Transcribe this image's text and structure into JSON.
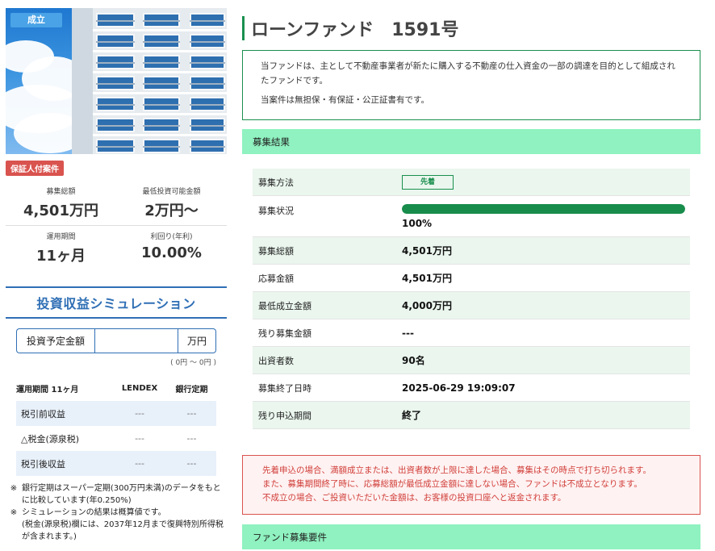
{
  "listing": {
    "status_badge": "成立",
    "guarantor_tag": "保証人付案件",
    "stats": [
      {
        "label": "募集総額",
        "value": "4,501万円"
      },
      {
        "label": "最低投資可能金額",
        "value": "2万円〜"
      },
      {
        "label": "運用期間",
        "value": "11ヶ月"
      },
      {
        "label": "利回り(年利)",
        "value": "10.00%"
      }
    ]
  },
  "simulation": {
    "title": "投資収益シミュレーション",
    "input_label": "投資予定金額",
    "input_value": "",
    "input_unit": "万円",
    "range_note": "( 0円 〜 0円 )",
    "table": {
      "headers": [
        "運用期間 11ヶ月",
        "LENDEX",
        "銀行定期"
      ],
      "rows": [
        {
          "label": "税引前収益",
          "lendex": "---",
          "bank": "---"
        },
        {
          "label": "△税金(源泉税)",
          "lendex": "---",
          "bank": "---"
        },
        {
          "label": "税引後収益",
          "lendex": "---",
          "bank": "---"
        }
      ]
    },
    "notes": [
      {
        "mark": "※",
        "text": "銀行定期はスーパー定期(300万円未満)のデータをもとに比較しています(年0.250%)"
      },
      {
        "mark": "※",
        "text": "シミュレーションの結果は概算値です。"
      }
    ],
    "note_sub": "(税金(源泉税)欄には、2037年12月まで復興特別所得税が含まれます。)"
  },
  "fund": {
    "title": "ローンファンド",
    "number": "1591号",
    "description": [
      "当ファンドは、主として不動産事業者が新たに購入する不動産の仕入資金の一部の調達を目的として組成されたファンドです。",
      "当案件は無担保・有保証・公正証書有です。"
    ]
  },
  "results": {
    "section_title": "募集結果",
    "method_label": "募集方法",
    "method_badge": "先着",
    "status_label": "募集状況",
    "progress_percent": 100,
    "progress_text": "100%",
    "rows": [
      {
        "label": "募集総額",
        "value": "4,501万円"
      },
      {
        "label": "応募金額",
        "value": "4,501万円"
      },
      {
        "label": "最低成立金額",
        "value": "4,000万円"
      },
      {
        "label": "残り募集金額",
        "value": "---"
      },
      {
        "label": "出資者数",
        "value": "90名"
      },
      {
        "label": "募集終了日時",
        "value": "2025-06-29 19:09:07"
      },
      {
        "label": "残り申込期間",
        "value": "終了"
      }
    ]
  },
  "warning": [
    "先着申込の場合、満額成立または、出資者数が上限に達した場合、募集はその時点で打ち切られます。",
    "また、募集期間終了時に、応募総額が最低成立金額に達しない場合、ファンドは不成立となります。",
    "不成立の場合、ご投資いただいた金額は、お客様の投資口座へと返金されます。"
  ],
  "requirements": {
    "section_title": "ファンド募集要件"
  },
  "colors": {
    "accent_green": "#1a8f4e",
    "section_green": "#8ff2c0",
    "link_blue": "#2f6fb5",
    "warning_red": "#d0403b"
  }
}
